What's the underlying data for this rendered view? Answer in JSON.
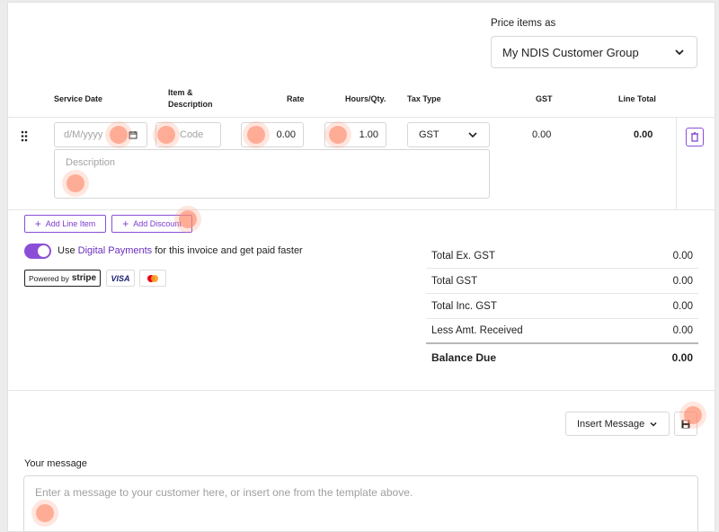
{
  "price_items": {
    "label": "Price items as",
    "selected": "My NDIS Customer Group"
  },
  "table": {
    "headers": {
      "service_date": "Service Date",
      "item_line1": "Item &",
      "item_line2": "Description",
      "rate": "Rate",
      "hours": "Hours/Qty.",
      "tax_type": "Tax Type",
      "gst": "GST",
      "line_total": "Line Total"
    },
    "row": {
      "date_placeholder": "d/M/yyyy",
      "code_placeholder": "Code",
      "rate": "0.00",
      "hours": "1.00",
      "tax_type": "GST",
      "gst": "0.00",
      "line_total": "0.00",
      "description_placeholder": "Description"
    }
  },
  "actions": {
    "add_line_item": "Add Line Item",
    "add_discount": "Add Discount"
  },
  "payments": {
    "text_before": "Use",
    "link": "Digital Payments",
    "text_after": "for this invoice and get paid faster",
    "stripe_prefix": "Powered by",
    "stripe_brand": "stripe",
    "visa": "VISA",
    "toggle_on": true
  },
  "totals": [
    {
      "label": "Total Ex. GST",
      "value": "0.00"
    },
    {
      "label": "Total GST",
      "value": "0.00"
    },
    {
      "label": "Total Inc. GST",
      "value": "0.00"
    },
    {
      "label": "Less Amt. Received",
      "value": "0.00"
    }
  ],
  "balance": {
    "label": "Balance Due",
    "value": "0.00"
  },
  "message": {
    "insert_label": "Insert Message",
    "your_message_label": "Your message",
    "placeholder": "Enter a message to your customer here, or insert one from the template above."
  },
  "icons": {
    "chevron": "chevron-down-icon",
    "calendar": "calendar-icon",
    "trash": "trash-icon",
    "drag": "drag-handle-icon",
    "plus": "plus-icon",
    "save": "save-icon"
  },
  "colors": {
    "accent": "#8a4fd6",
    "link": "#6a2fc0",
    "highlight": "#ff8c6e"
  }
}
